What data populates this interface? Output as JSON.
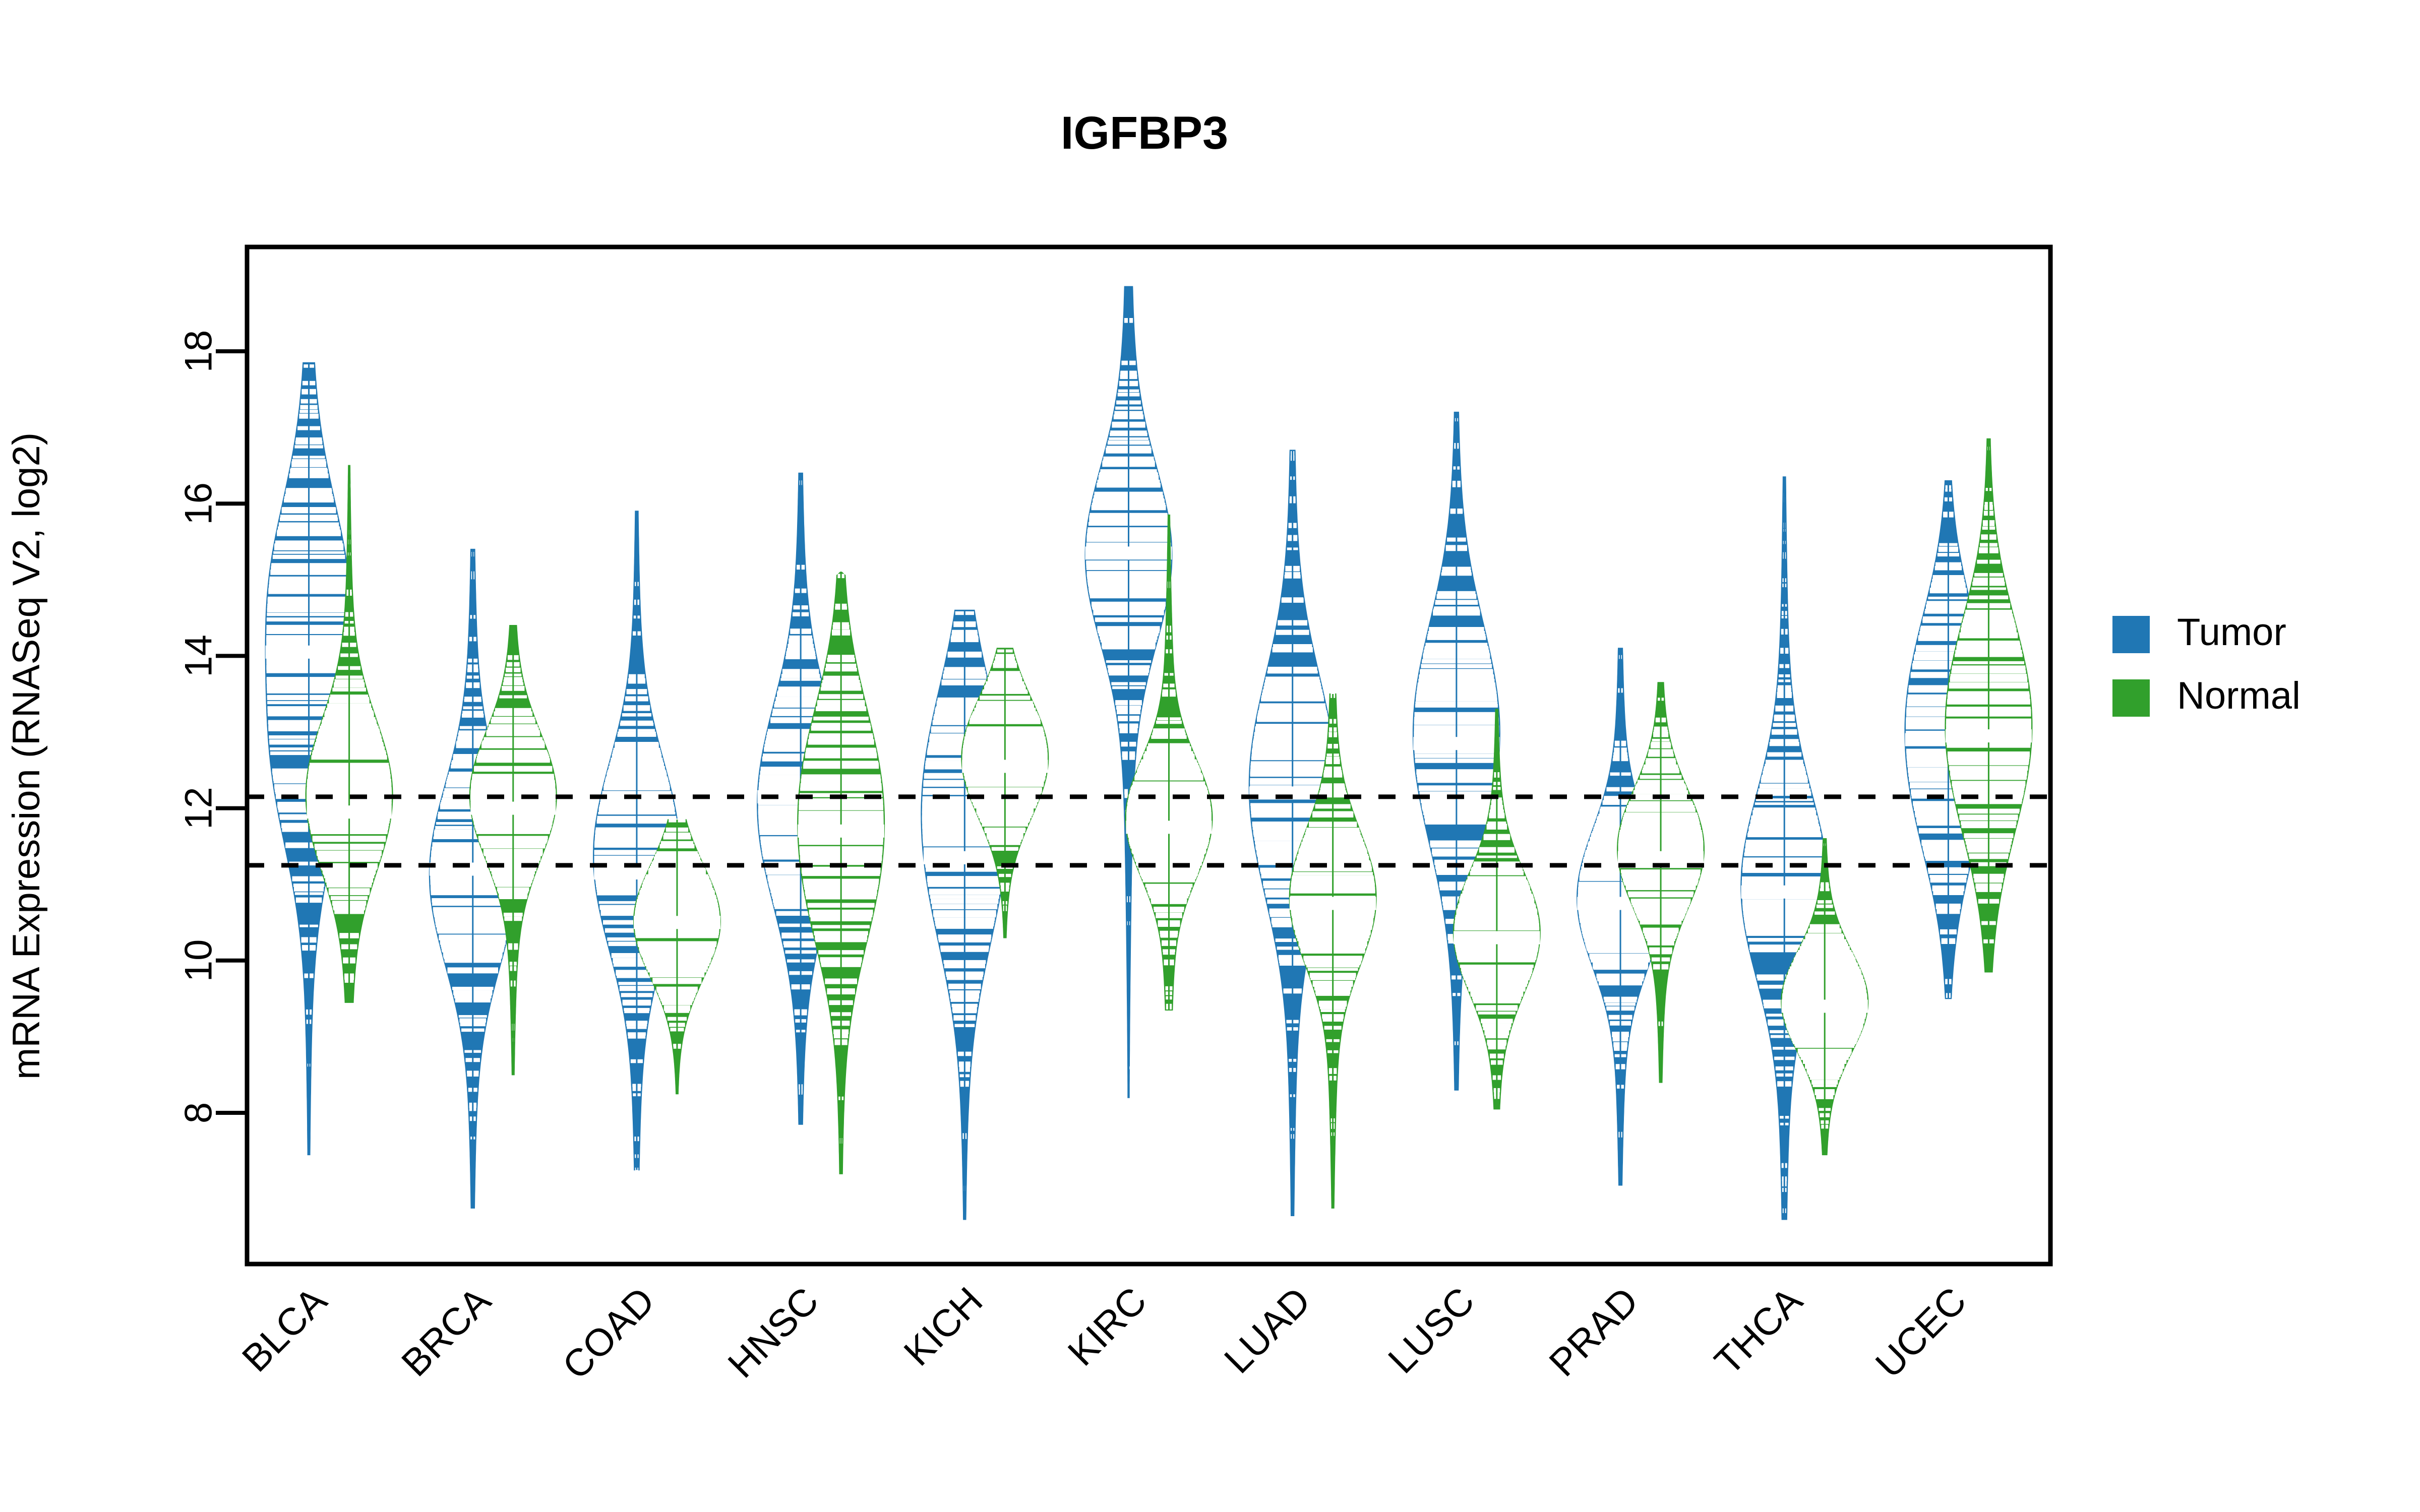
{
  "chart_data": {
    "type": "violin",
    "title": "IGFBP3",
    "xlabel": "",
    "ylabel": "mRNA Expression (RNASeq V2, log2)",
    "ylim": [
      6.6,
      19.3
    ],
    "yticks": [
      8,
      10,
      12,
      14,
      16,
      18
    ],
    "ytick_labels": [
      "8",
      "10",
      "12",
      "14",
      "16",
      "18"
    ],
    "grid": false,
    "legend_position": "right",
    "legend": [
      {
        "name": "Tumor",
        "color": "#2077b4"
      },
      {
        "name": "Normal",
        "color": "#31a02c"
      }
    ],
    "reference_lines": [
      {
        "value": 12.15,
        "style": "dotted",
        "color": "#000000"
      },
      {
        "value": 11.25,
        "style": "dotted",
        "color": "#000000"
      }
    ],
    "categories": [
      "BLCA",
      "BRCA",
      "COAD",
      "HNSC",
      "KICH",
      "KIRC",
      "LUAD",
      "LUSC",
      "PRAD",
      "THCA",
      "UCEC"
    ],
    "series": [
      {
        "name": "Tumor",
        "color": "#2077b4",
        "groups": [
          {
            "category": "BLCA",
            "median": 14.05,
            "q1": 12.85,
            "q3": 15.25,
            "min": 7.45,
            "max": 17.85,
            "peaks": [
              14.9,
              12.6
            ]
          },
          {
            "category": "BRCA",
            "median": 11.2,
            "q1": 10.25,
            "q3": 12.25,
            "min": 6.75,
            "max": 15.4,
            "peaks": [
              11.6,
              10.6
            ]
          },
          {
            "category": "COAD",
            "median": 11.15,
            "q1": 10.1,
            "q3": 12.1,
            "min": 7.25,
            "max": 15.9,
            "peaks": [
              11.9,
              10.8
            ]
          },
          {
            "category": "HNSC",
            "median": 12.15,
            "q1": 11.0,
            "q3": 13.1,
            "min": 7.85,
            "max": 16.4,
            "peaks": [
              12.6,
              11.4
            ]
          },
          {
            "category": "KICH",
            "median": 11.35,
            "q1": 10.5,
            "q3": 12.85,
            "min": 6.6,
            "max": 14.6,
            "peaks": [
              12.7,
              11.1
            ]
          },
          {
            "category": "KIRC",
            "median": 15.35,
            "q1": 14.25,
            "q3": 16.35,
            "min": 8.2,
            "max": 18.85,
            "peaks": [
              15.7,
              14.9
            ]
          },
          {
            "category": "LUAD",
            "median": 12.2,
            "q1": 11.0,
            "q3": 13.3,
            "min": 6.65,
            "max": 16.7,
            "peaks": [
              12.9,
              11.6
            ]
          },
          {
            "category": "LUSC",
            "median": 12.85,
            "q1": 11.8,
            "q3": 14.1,
            "min": 8.3,
            "max": 17.2,
            "peaks": [
              13.6,
              12.3
            ]
          },
          {
            "category": "PRAD",
            "median": 10.75,
            "q1": 10.1,
            "q3": 11.6,
            "min": 7.05,
            "max": 14.1,
            "peaks": [
              11.2,
              10.4
            ]
          },
          {
            "category": "THCA",
            "median": 10.9,
            "q1": 9.85,
            "q3": 12.0,
            "min": 6.6,
            "max": 16.35,
            "peaks": [
              11.4,
              10.5
            ]
          },
          {
            "category": "UCEC",
            "median": 12.9,
            "q1": 11.85,
            "q3": 14.0,
            "min": 9.5,
            "max": 16.3,
            "peaks": [
              13.7,
              12.2
            ]
          }
        ]
      },
      {
        "name": "Normal",
        "color": "#31a02c",
        "groups": [
          {
            "category": "BLCA",
            "median": 11.95,
            "q1": 11.3,
            "q3": 12.9,
            "min": 9.45,
            "max": 16.5,
            "peaks": [
              12.6,
              11.7
            ]
          },
          {
            "category": "BRCA",
            "median": 12.0,
            "q1": 11.35,
            "q3": 12.75,
            "min": 8.5,
            "max": 14.4,
            "peaks": [
              12.5,
              11.8
            ]
          },
          {
            "category": "COAD",
            "median": 10.5,
            "q1": 9.95,
            "q3": 11.2,
            "min": 8.25,
            "max": 11.85,
            "peaks": [
              10.8,
              10.2
            ]
          },
          {
            "category": "HNSC",
            "median": 11.7,
            "q1": 10.6,
            "q3": 12.7,
            "min": 7.2,
            "max": 15.1,
            "peaks": [
              12.5,
              11.0
            ]
          },
          {
            "category": "KICH",
            "median": 12.55,
            "q1": 12.0,
            "q3": 13.25,
            "min": 10.3,
            "max": 14.1,
            "peaks": [
              13.0,
              12.3
            ]
          },
          {
            "category": "KIRC",
            "median": 11.75,
            "q1": 11.2,
            "q3": 12.45,
            "min": 9.35,
            "max": 15.85,
            "peaks": [
              12.2,
              11.5
            ]
          },
          {
            "category": "LUAD",
            "median": 10.75,
            "q1": 10.1,
            "q3": 11.5,
            "min": 6.75,
            "max": 13.5,
            "peaks": [
              11.2,
              10.4
            ]
          },
          {
            "category": "LUSC",
            "median": 10.3,
            "q1": 9.7,
            "q3": 11.0,
            "min": 8.05,
            "max": 13.3,
            "peaks": [
              10.7,
              10.0
            ]
          },
          {
            "category": "PRAD",
            "median": 11.35,
            "q1": 10.8,
            "q3": 12.05,
            "min": 8.4,
            "max": 13.65,
            "peaks": [
              11.8,
              11.1
            ]
          },
          {
            "category": "THCA",
            "median": 9.4,
            "q1": 8.9,
            "q3": 10.05,
            "min": 7.45,
            "max": 11.6,
            "peaks": [
              9.7,
              9.2
            ]
          },
          {
            "category": "UCEC",
            "median": 12.95,
            "q1": 12.0,
            "q3": 14.1,
            "min": 9.85,
            "max": 16.85,
            "peaks": [
              13.7,
              12.4
            ]
          }
        ]
      }
    ]
  },
  "axis": {
    "y_title": "mRNA Expression (RNASeq V2, log2)",
    "y_tick_labels": [
      "8",
      "10",
      "12",
      "14",
      "16",
      "18"
    ],
    "x_tick_labels": [
      "BLCA",
      "BRCA",
      "COAD",
      "HNSC",
      "KICH",
      "KIRC",
      "LUAD",
      "LUSC",
      "PRAD",
      "THCA",
      "UCEC"
    ]
  },
  "header": {
    "title": "IGFBP3"
  },
  "legend": {
    "items": [
      {
        "label": "Tumor",
        "color": "#2077b4"
      },
      {
        "label": "Normal",
        "color": "#31a02c"
      }
    ]
  }
}
